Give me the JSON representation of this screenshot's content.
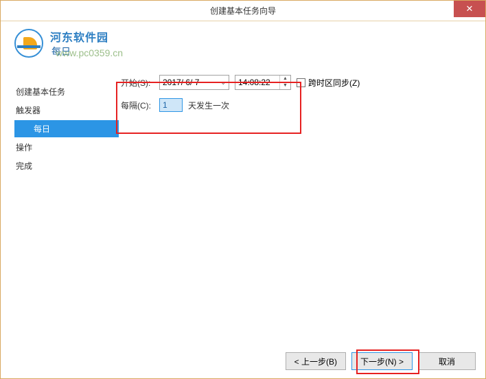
{
  "titlebar": {
    "title": "创建基本任务向导"
  },
  "header": {
    "brand_cn": "河东软件园",
    "page_title": "每日",
    "watermark": "www.pc0359.cn"
  },
  "sidebar": {
    "items": [
      {
        "label": "创建基本任务",
        "indent": false,
        "selected": false
      },
      {
        "label": "触发器",
        "indent": false,
        "selected": false
      },
      {
        "label": "每日",
        "indent": true,
        "selected": true
      },
      {
        "label": "操作",
        "indent": false,
        "selected": false
      },
      {
        "label": "完成",
        "indent": false,
        "selected": false
      }
    ]
  },
  "form": {
    "start_label": "开始(S):",
    "date_value": "2017/ 6/ 7",
    "time_value": "14:08:22",
    "tz_checkbox_label": "跨时区同步(Z)",
    "interval_label": "每隔(C):",
    "interval_value": "1",
    "interval_suffix": "天发生一次"
  },
  "footer": {
    "back": "< 上一步(B)",
    "next": "下一步(N) >",
    "cancel": "取消"
  }
}
